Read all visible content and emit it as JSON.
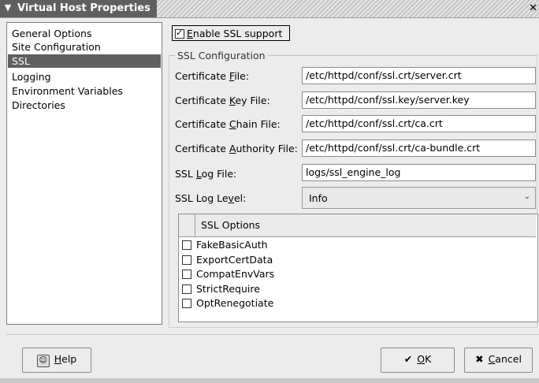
{
  "window": {
    "title": "Virtual Host Properties"
  },
  "sidebar": {
    "items": [
      {
        "label": "General Options"
      },
      {
        "label": "Site Configuration"
      },
      {
        "label": "SSL"
      },
      {
        "label": "Logging"
      },
      {
        "label": "Environment Variables"
      },
      {
        "label": "Directories"
      }
    ],
    "selected": "SSL"
  },
  "ssl": {
    "enable_label_pre": "",
    "enable_label_u": "E",
    "enable_label_post": "nable SSL support",
    "enabled": true,
    "group_title": "SSL Configuration",
    "fields": [
      {
        "pre": "Certificate ",
        "u": "F",
        "post": "ile:",
        "value": "/etc/httpd/conf/ssl.crt/server.crt"
      },
      {
        "pre": "Certificate ",
        "u": "K",
        "post": "ey File:",
        "value": "/etc/httpd/conf/ssl.key/server.key"
      },
      {
        "pre": "Certificate ",
        "u": "C",
        "post": "hain File:",
        "value": "/etc/httpd/conf/ssl.crt/ca.crt"
      },
      {
        "pre": "Certificate ",
        "u": "A",
        "post": "uthority File:",
        "value": "/etc/httpd/conf/ssl.crt/ca-bundle.crt"
      },
      {
        "pre": "SSL ",
        "u": "L",
        "post": "og File:",
        "value": "logs/ssl_engine_log"
      }
    ],
    "log_level": {
      "pre": "SSL Log Le",
      "u": "v",
      "post": "el:",
      "value": "Info"
    },
    "options_header": "SSL Options",
    "options": [
      {
        "label": "FakeBasicAuth",
        "checked": false
      },
      {
        "label": "ExportCertData",
        "checked": false
      },
      {
        "label": "CompatEnvVars",
        "checked": false
      },
      {
        "label": "StrictRequire",
        "checked": false
      },
      {
        "label": "OptRenegotiate",
        "checked": false
      }
    ]
  },
  "buttons": {
    "help": {
      "u": "H",
      "post": "elp",
      "icon": "help-icon"
    },
    "ok": {
      "u": "O",
      "post": "K",
      "icon": "ok-check-icon"
    },
    "cancel": {
      "u": "C",
      "post": "ancel",
      "icon": "cancel-x-icon"
    }
  }
}
